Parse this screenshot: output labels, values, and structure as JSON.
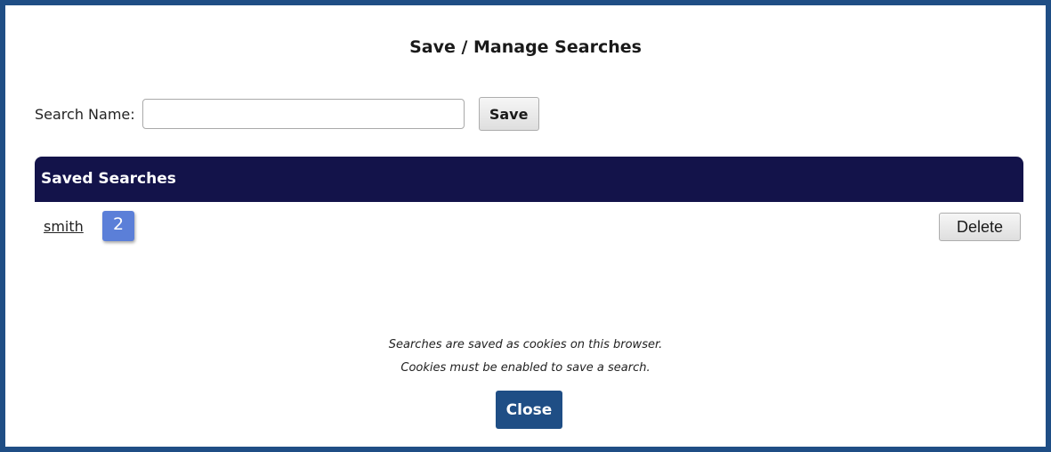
{
  "dialog": {
    "title": "Save / Manage Searches",
    "border_color": "#1f4e85"
  },
  "search_name": {
    "label": "Search Name:",
    "value": "",
    "placeholder": "",
    "save_label": "Save"
  },
  "saved_searches": {
    "header": "Saved Searches",
    "header_color": "#13134a",
    "items": [
      {
        "name": "smith",
        "count": "2",
        "badge_color": "#5b7fd8",
        "delete_label": "Delete"
      }
    ]
  },
  "footer": {
    "note_line1": "Searches are saved as cookies on this browser.",
    "note_line2": "Cookies must be enabled to save a search.",
    "close_label": "Close",
    "close_color": "#1f4e85"
  }
}
